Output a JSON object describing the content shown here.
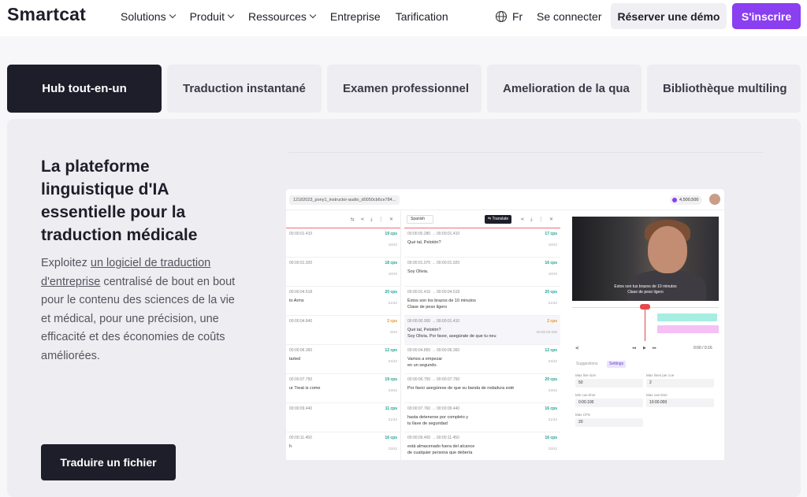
{
  "nav": {
    "logo": "Smartcat",
    "links": [
      "Solutions",
      "Produit",
      "Ressources",
      "Entreprise",
      "Tarification"
    ],
    "language": "Fr",
    "login": "Se connecter",
    "demo_button": "Réserver une démo",
    "signup_button": "S'inscrire"
  },
  "tabs": [
    "Hub tout-en-un",
    "Traduction instantané",
    "Examen professionnel",
    "Amelioration de la qua",
    "Bibliothèque multiling"
  ],
  "hero": {
    "headline": "La plateforme linguistique d'IA essentielle pour la traduction médicale",
    "desc_before": "Exploitez ",
    "desc_link": "un logiciel de traduction d'entreprise",
    "desc_after": " centralisé de bout en bout pour le contenu des sciences de la vie et médical, pour une précision, une efficacité et des économies de coûts améliorées.",
    "cta": "Traduire un fichier"
  },
  "app": {
    "file_name": "12182023_pony1_instructor-audio_d0050cb6ce784...",
    "credits": "4,500,500",
    "source_segments": [
      {
        "tc": "00:00:01.410",
        "cps": "19 cps",
        "text": "",
        "meta": "16/42"
      },
      {
        "tc": "00:00:01.920",
        "cps": "18 cps",
        "text": "",
        "meta": "16/42"
      },
      {
        "tc": "00:00:04.518",
        "cps": "20 cps",
        "text": "to Arms",
        "meta": "21/42"
      },
      {
        "tc": "00:00:04.840",
        "cps": "2 cps",
        "text": "",
        "meta": "8/42"
      },
      {
        "tc": "00:00:06.360",
        "cps": "12 cps",
        "text": "tarted",
        "meta": "24/42"
      },
      {
        "tc": "00:00:07.750",
        "cps": "19 cps",
        "text": "ur Treat is come",
        "meta": "23/42"
      },
      {
        "tc": "00:00:09.440",
        "cps": "11 cps",
        "text": "",
        "meta": "21/42"
      },
      {
        "tc": "00:00:11.450",
        "cps": "16 cps",
        "text": "h",
        "meta": "23/42"
      }
    ],
    "target_language": "Spanish",
    "translate_label": "Translate",
    "target_segments": [
      {
        "tc1": "00:00:00.280",
        "tc2": "00:00:01.410",
        "cps": "17 cps",
        "text": "Qué tal, Pelotón?",
        "meta": "16/42"
      },
      {
        "tc1": "00:00:01.070",
        "tc2": "00:00:01.920",
        "cps": "16 cps",
        "text": "Soy Olivia.",
        "meta": "16/42"
      },
      {
        "tc1": "00:00:01.410",
        "tc2": "00:00:04.518",
        "cps": "20 cps",
        "text": "Éstos son los brazos de 10 minutos",
        "text2": "Clase de peso ligero",
        "meta": "21/42"
      },
      {
        "tc1": "00:00:00.000",
        "tc2": "00:00:01.410",
        "cps": "2 cps",
        "text": "Qué tal, Pelotón?",
        "text2": "Soy Olivia. Por favor, asegúrate de que tu neu",
        "meta": "00:00:00.000"
      },
      {
        "tc1": "00:00:04.850",
        "tc2": "00:00:06.360",
        "cps": "12 cps",
        "text": "Vamos a empezar",
        "text2": "en un segundo.",
        "meta": "24/42"
      },
      {
        "tc1": "00:00:06.750",
        "tc2": "00:00:07.750",
        "cps": "20 cps",
        "text": "Por favor asegúrese de que su banda de rodadura esté",
        "meta": "23/42"
      },
      {
        "tc1": "00:00:07.760",
        "tc2": "00:00:09.440",
        "cps": "16 cps",
        "text": "hasta detenerse por completo y",
        "text2": "tu llave de seguridad",
        "meta": "21/42"
      },
      {
        "tc1": "00:00:09.450",
        "tc2": "00:00:11.450",
        "cps": "16 cps",
        "text": "está almacenado fuera del alcance",
        "text2": "de cualquier persona que debería",
        "meta": "23/42"
      }
    ],
    "video_caption_1": "Estos son tus brazos de 10 minutos",
    "video_caption_2": "Clase de peso ligero",
    "time_readout": "0:00 / 0:16",
    "settings_tabs": [
      "Suggestions",
      "Settings"
    ],
    "fields": [
      {
        "label": "Max line size",
        "value": "50"
      },
      {
        "label": "Max lines per cue",
        "value": "2"
      },
      {
        "label": "Min cue time",
        "value": "0:00.100"
      },
      {
        "label": "Max cue time",
        "value": "10:00.000"
      },
      {
        "label": "Max CPS",
        "value": "20"
      }
    ]
  },
  "colors": {
    "accent": "#8a3ff0",
    "dark": "#1e1e2a",
    "panel": "#eeedf1"
  }
}
